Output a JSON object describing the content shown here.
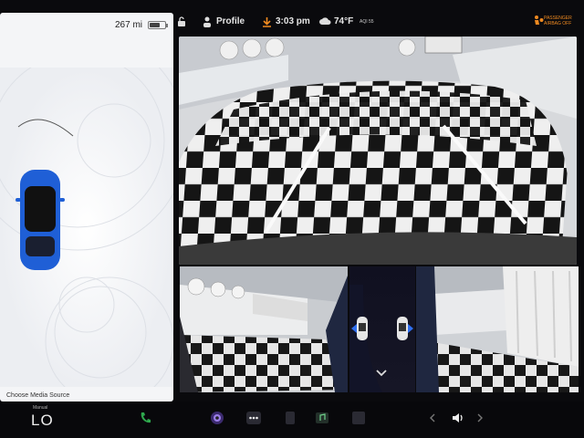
{
  "left_panel": {
    "range": "267 mi",
    "battery_level": 0.7,
    "media_source_label": "Choose Media Source"
  },
  "status_bar": {
    "profile_label": "Profile",
    "time": "3:03 pm",
    "temperature": "74°F",
    "aqi_label": "AQI 55",
    "airbag_line1": "PASSENGER",
    "airbag_line2": "AIRBAG OFF"
  },
  "drive": {
    "mode_label": "Manual",
    "gear": "LO"
  },
  "colors": {
    "car_blue": "#1f5fd6",
    "accent_blue": "#2f6ff0",
    "airbag_orange": "#f08a20",
    "phone_green": "#2ea84d"
  },
  "icons": [
    "lock-icon",
    "profile-icon",
    "download-icon",
    "cloud-icon",
    "airbag-warning-icon",
    "phone-icon",
    "camera-app-icon",
    "more-apps-icon",
    "music-app-icon",
    "volume-icon",
    "expand-chevron-icon"
  ]
}
